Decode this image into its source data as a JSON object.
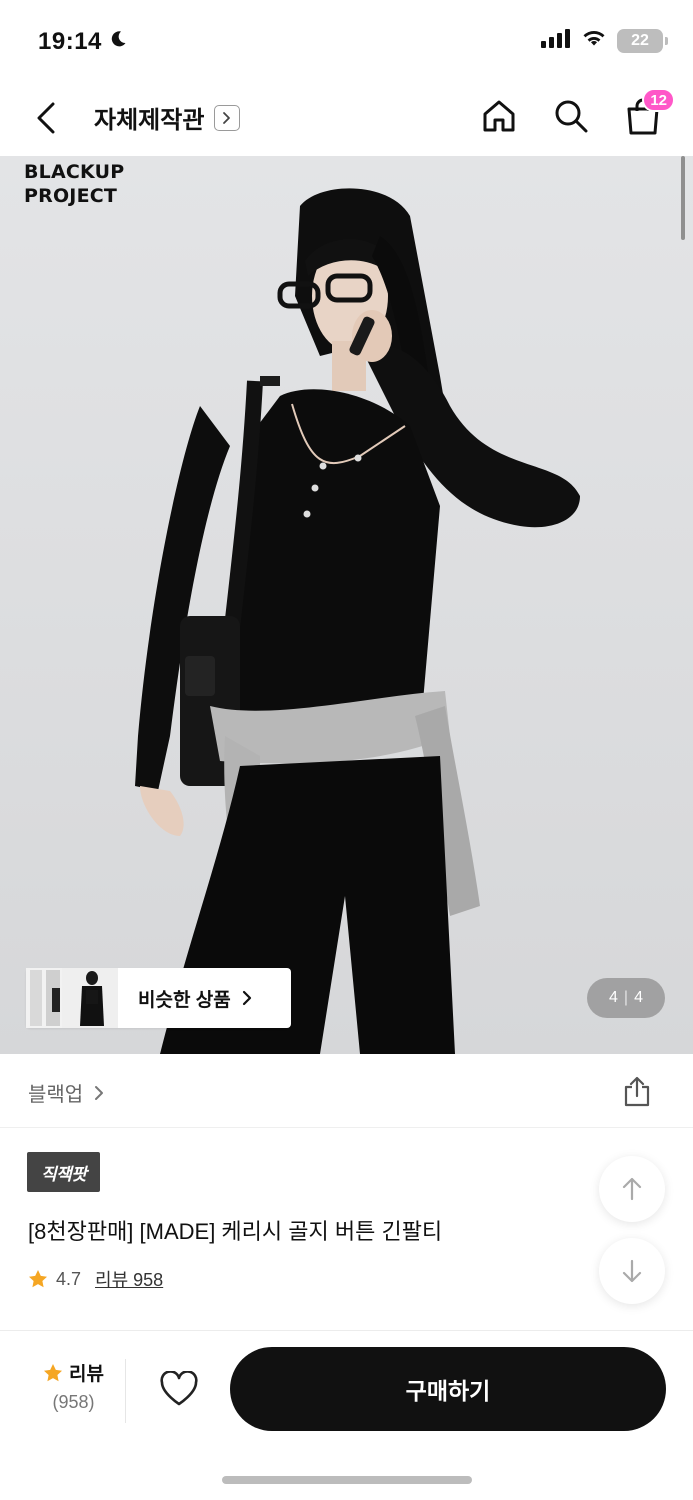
{
  "status_bar": {
    "time": "19:14",
    "battery": "22",
    "icons": [
      "moon-icon",
      "signal-icon",
      "wifi-icon",
      "battery-icon"
    ]
  },
  "header": {
    "title": "자체제작관",
    "cart_count": "12",
    "icons": [
      "back-icon",
      "chevron-right-icon",
      "home-icon",
      "search-icon",
      "cart-icon"
    ],
    "badge_color": "#ff57c8"
  },
  "gallery": {
    "watermark_line1": "BLACKUP",
    "watermark_line2": "PROJECT",
    "similar_label": "비슷한 상품",
    "page_current": "4",
    "page_separator": "|",
    "page_total": "4"
  },
  "brand": {
    "name": "블랙업",
    "icons": [
      "chevron-right-icon",
      "share-icon"
    ]
  },
  "product": {
    "badge": "직잭팟",
    "name": "[8천장판매] [MADE] 케리시 골지 버튼 긴팔티",
    "rating": "4.7",
    "review_link": "리뷰 958",
    "star_color": "#f5a623"
  },
  "bottom_bar": {
    "review_label": "리뷰",
    "review_count": "(958)",
    "buy_label": "구매하기",
    "buy_color": "#111111"
  }
}
